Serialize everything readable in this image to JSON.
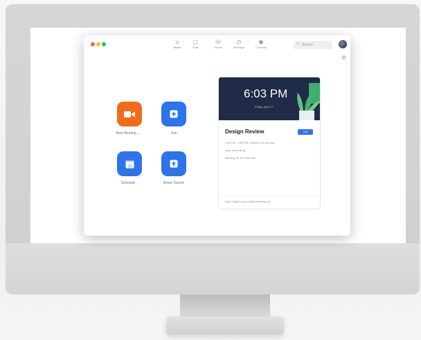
{
  "app": {
    "nav": [
      {
        "label": "Home",
        "icon": "home-icon",
        "active": true
      },
      {
        "label": "Chat",
        "icon": "chat-icon",
        "active": false
      },
      {
        "label": "Phone",
        "icon": "phone-icon",
        "active": false
      },
      {
        "label": "Meetings",
        "icon": "clock-icon",
        "active": false
      },
      {
        "label": "Contacts",
        "icon": "contacts-icon",
        "active": false
      }
    ],
    "search": {
      "placeholder": "Search"
    },
    "actions": {
      "new_meeting": "New Meeting ⌄",
      "join": "Join",
      "schedule": "Schedule",
      "schedule_day": "12",
      "share_screen": "Share Screen"
    },
    "meeting_card": {
      "time": "6:03 PM",
      "date": "Friday, April 17",
      "title": "Design Review",
      "join_label": "Join",
      "details": [
        "1:00 PM - 2:30 PM  |  Starts in 15 minutes",
        "Host: Anna Berg",
        "Meeting ID: 572-589-001"
      ],
      "footer": "View Today's Upcoming Meetings (3)"
    },
    "colors": {
      "accent_blue": "#2d73ea",
      "accent_orange": "#f26b1d",
      "banner": "#1f2b47"
    }
  }
}
